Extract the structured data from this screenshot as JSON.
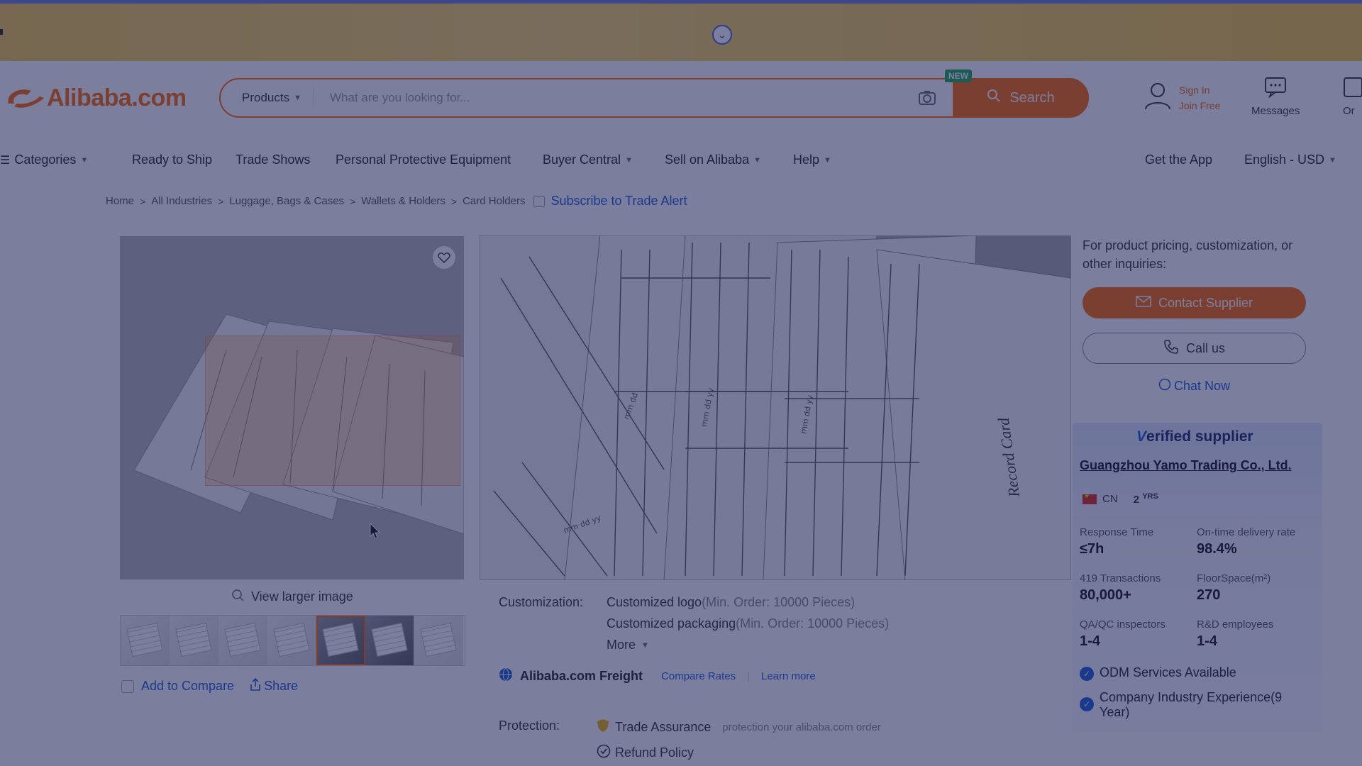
{
  "header": {
    "logo_text": "Alibaba.com",
    "search": {
      "type_label": "Products",
      "placeholder": "What are you looking for...",
      "button_label": "Search",
      "new_badge": "NEW"
    },
    "sign_in": "Sign In",
    "join_free": "Join Free",
    "messages": "Messages",
    "orders": "Or"
  },
  "nav": {
    "categories": "Categories",
    "items": [
      "Ready to Ship",
      "Trade Shows",
      "Personal Protective Equipment",
      "Buyer Central",
      "Sell on Alibaba",
      "Help"
    ],
    "get_app": "Get the App",
    "language": "English - USD"
  },
  "breadcrumb": {
    "items": [
      "Home",
      "All Industries",
      "Luggage, Bags & Cases",
      "Wallets & Holders",
      "Card Holders"
    ],
    "subscribe": "Subscribe to Trade Alert"
  },
  "gallery": {
    "view_larger": "View larger image",
    "add_to_compare": "Add to Compare",
    "share": "Share"
  },
  "detail": {
    "record_card_label": "Record Card",
    "customization_label": "Customization:",
    "custom_logo": "Customized logo",
    "custom_logo_min": "(Min. Order: 10000 Pieces)",
    "custom_packaging": "Customized packaging",
    "custom_packaging_min": "(Min. Order: 10000 Pieces)",
    "more": "More",
    "freight_name": "Alibaba.com Freight",
    "compare_rates": "Compare Rates",
    "learn_more": "Learn more",
    "protection_label": "Protection:",
    "trade_assurance": "Trade Assurance",
    "trade_assurance_desc": "protection your alibaba.com order",
    "refund_policy": "Refund Policy"
  },
  "side": {
    "inquiry_text": "For product pricing, customization, or other inquiries:",
    "contact_supplier": "Contact Supplier",
    "call_us": "Call us",
    "chat_now": "Chat Now"
  },
  "supplier": {
    "verified_v": "V",
    "verified_rest": "erified supplier",
    "company": "Guangzhou Yamo Trading Co., Ltd.",
    "country": "CN",
    "years": "2",
    "years_unit": "YRS",
    "stats": [
      {
        "label": "Response Time",
        "value": "≤7h"
      },
      {
        "label": "On-time delivery rate",
        "value": "98.4%"
      },
      {
        "label": "419 Transactions",
        "value": "80,000+"
      },
      {
        "label": "FloorSpace(m²)",
        "value": "270"
      },
      {
        "label": "QA/QC inspectors",
        "value": "1-4"
      },
      {
        "label": "R&D employees",
        "value": "1-4"
      }
    ],
    "features": [
      "ODM Services Available",
      "Company Industry Experience(9 Year)"
    ]
  },
  "colors": {
    "accent": "#ff6a00",
    "link": "#1c5bd9",
    "overlay": "#1c2054"
  }
}
